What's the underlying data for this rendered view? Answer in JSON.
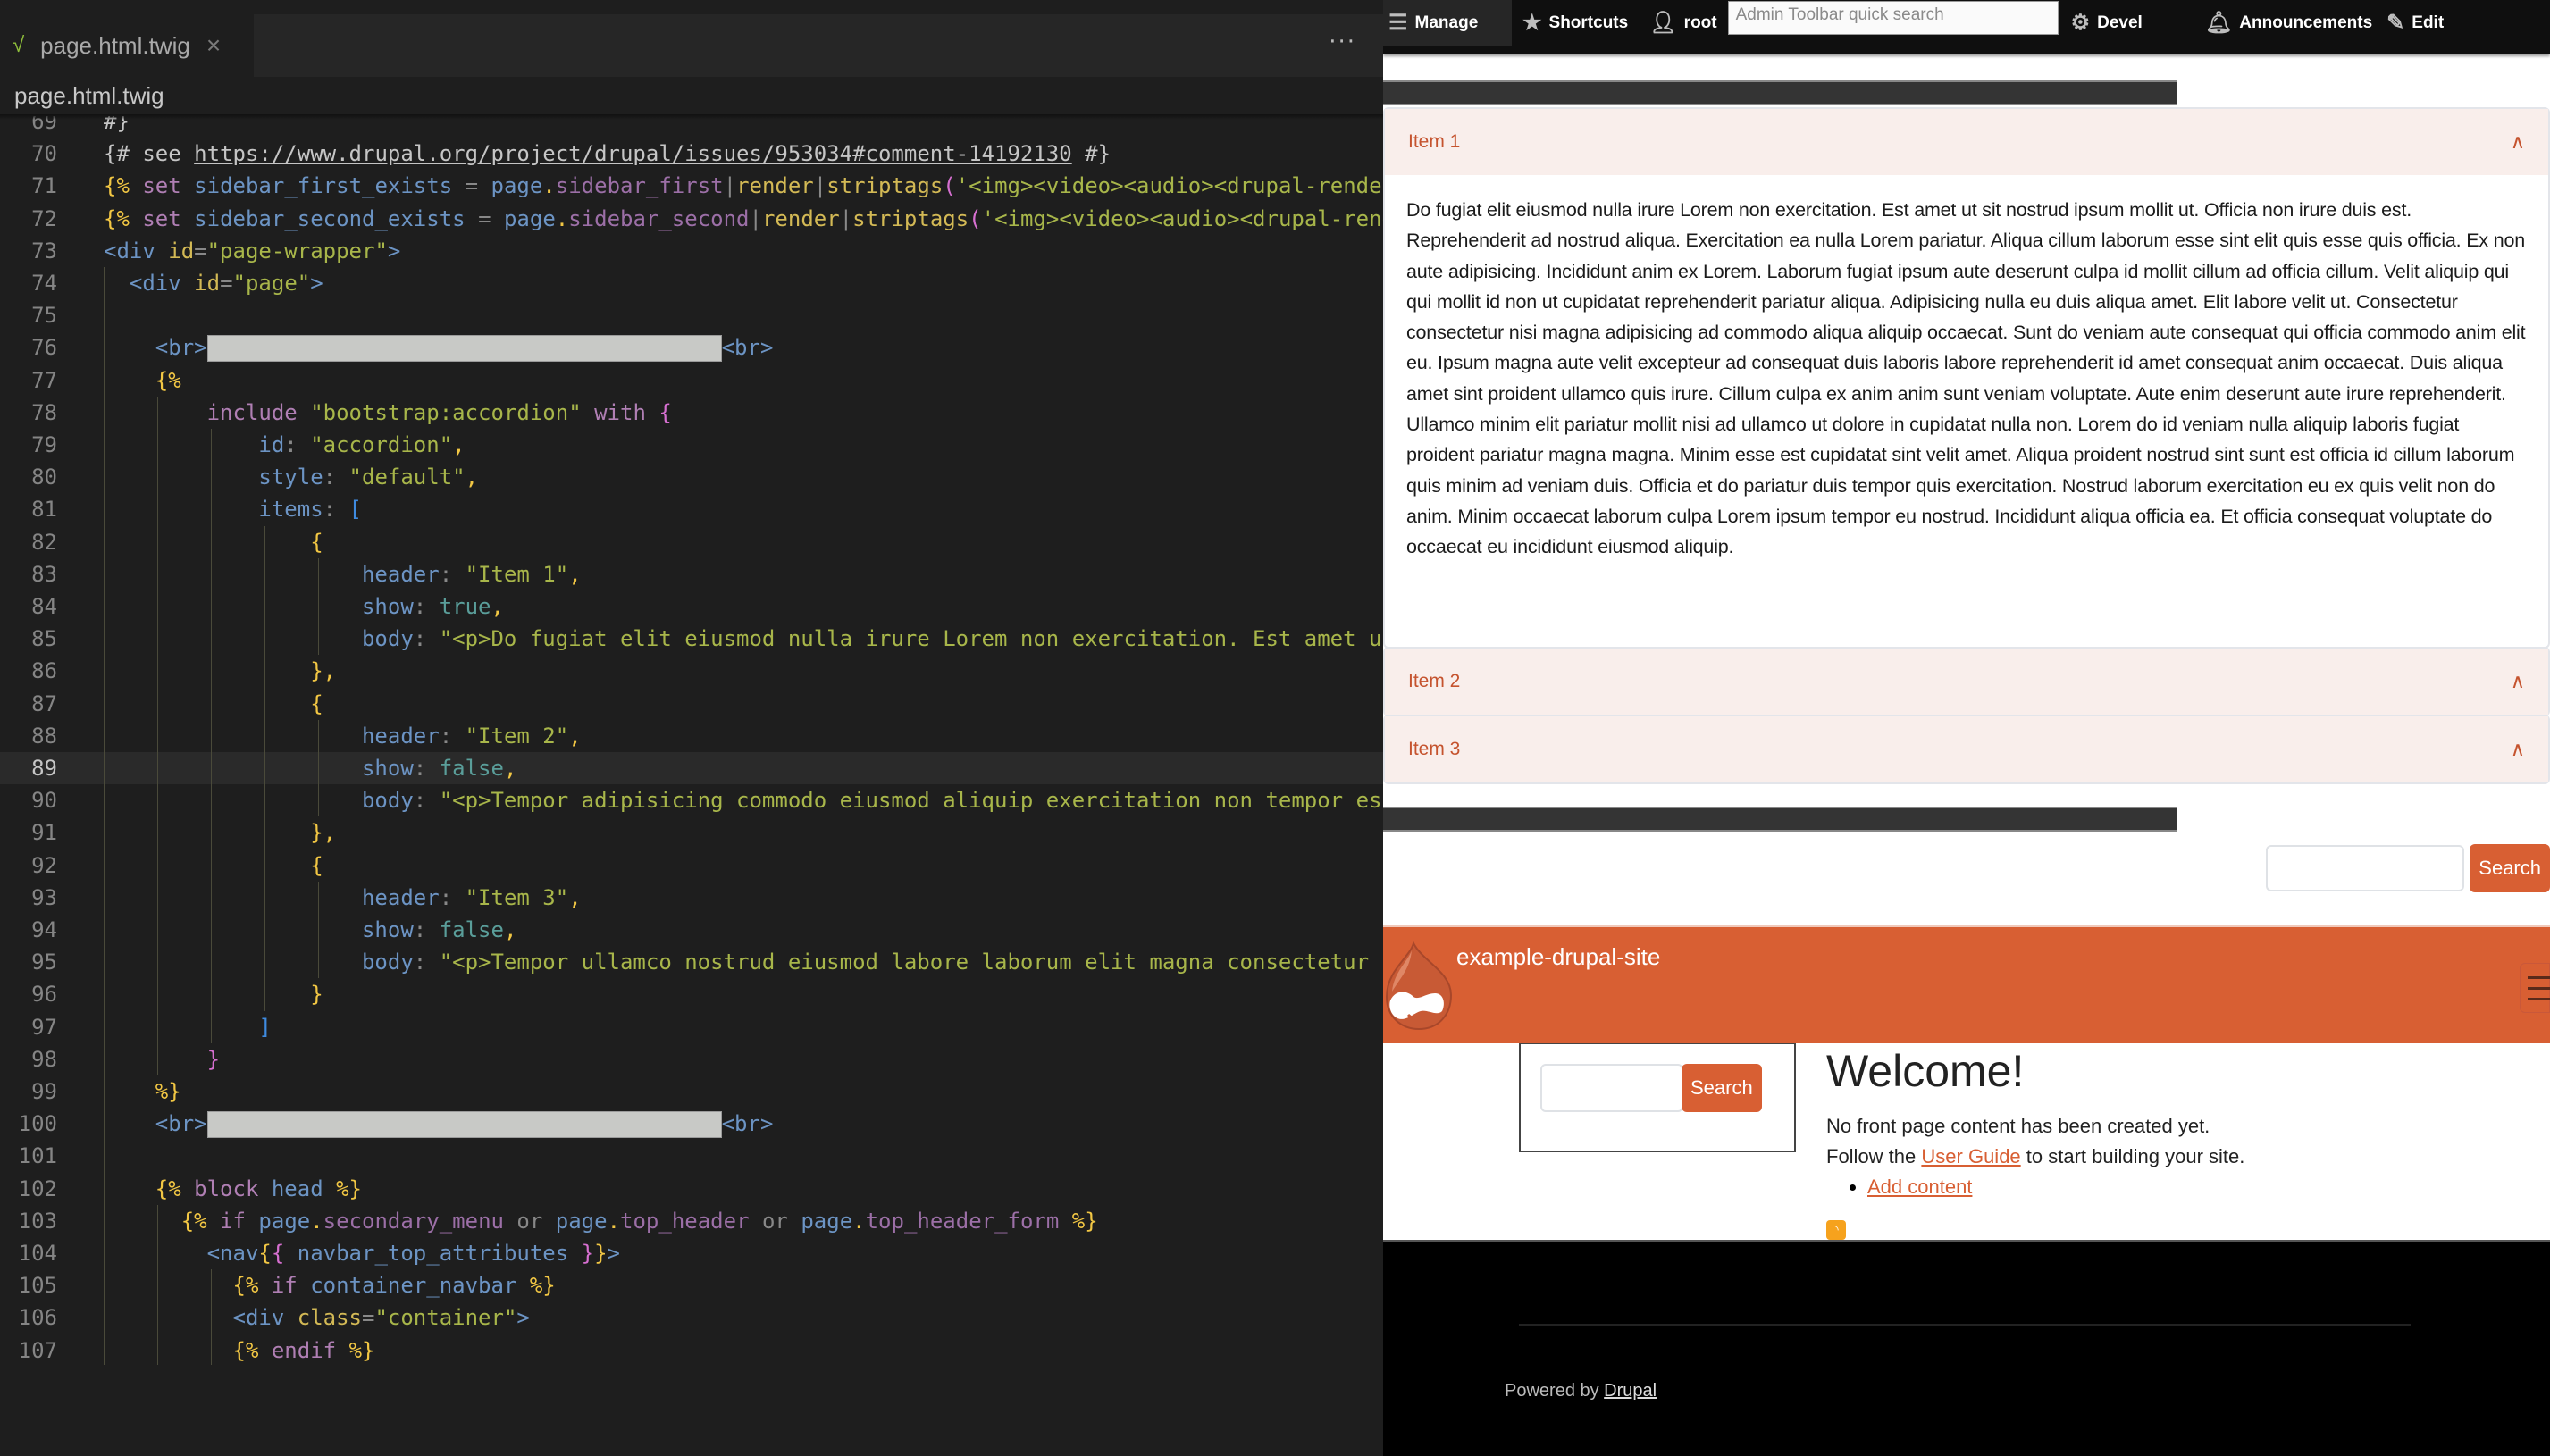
{
  "editor": {
    "tab": {
      "label": "page.html.twig",
      "icon": "twig-file-icon",
      "close": "×"
    },
    "more_actions": "···",
    "breadcrumb": "page.html.twig",
    "active_line": 89,
    "lines": [
      {
        "n": "69",
        "html": "<span class='t-com'>#}</span>",
        "guides": 0
      },
      {
        "n": "70",
        "html": "<span class='t-com'>{# see </span><span class='t-url'>https://www.drupal.org/project/drupal/issues/953034#comment-14192130</span><span class='t-com'> #}</span>",
        "guides": 0
      },
      {
        "n": "71",
        "html": "<span class='t-tw'>{%</span> <span class='t-kw'>set</span> <span class='t-var'>sidebar_first_exists</span> <span class='t-op'>=</span> <span class='t-var'>page</span><span class='t-tw'>.</span><span class='t-prop'>sidebar_first</span><span class='t-op'>|</span><span class='t-flt'>render</span><span class='t-op'>|</span><span class='t-flt'>striptags</span><span class='t-pink'>(</span><span class='t-str'>'&lt;img&gt;&lt;video&gt;&lt;audio&gt;&lt;drupal-render-placeholder&gt;'</span>",
        "guides": 0
      },
      {
        "n": "72",
        "html": "<span class='t-tw'>{%</span> <span class='t-kw'>set</span> <span class='t-var'>sidebar_second_exists</span> <span class='t-op'>=</span> <span class='t-var'>page</span><span class='t-tw'>.</span><span class='t-prop'>sidebar_second</span><span class='t-op'>|</span><span class='t-flt'>render</span><span class='t-op'>|</span><span class='t-flt'>striptags</span><span class='t-pink'>(</span><span class='t-str'>'&lt;img&gt;&lt;video&gt;&lt;audio&gt;&lt;drupal-render-placeholder&gt;'</span>",
        "guides": 0
      },
      {
        "n": "73",
        "html": "<span class='t-br'>&lt;div</span> <span class='t-attr'>id</span><span class='t-op'>=</span><span class='t-str'>\"page-wrapper\"</span><span class='t-br'>&gt;</span>",
        "guides": 0
      },
      {
        "n": "74",
        "html": "  <span class='t-br'>&lt;div</span> <span class='t-attr'>id</span><span class='t-op'>=</span><span class='t-str'>\"page\"</span><span class='t-br'>&gt;</span>",
        "guides": 1
      },
      {
        "n": "75",
        "html": "",
        "guides": 1
      },
      {
        "n": "76",
        "html": "    <span class='t-br'>&lt;br&gt;</span><span class='redact'></span><span class='t-br'>&lt;br&gt;</span>",
        "guides": 1
      },
      {
        "n": "77",
        "html": "    <span class='t-tw'>{%</span>",
        "guides": 1
      },
      {
        "n": "78",
        "html": "        <span class='t-kw'>include</span> <span class='t-str'>\"bootstrap:accordion\"</span> <span class='t-kw'>with</span> <span class='t-pink'>{</span>",
        "guides": 2
      },
      {
        "n": "79",
        "html": "            <span class='t-var'>id</span><span class='t-op'>:</span> <span class='t-str'>\"accordion\"</span><span class='t-tw'>,</span>",
        "guides": 3
      },
      {
        "n": "80",
        "html": "            <span class='t-var'>style</span><span class='t-op'>:</span> <span class='t-str'>\"default\"</span><span class='t-tw'>,</span>",
        "guides": 3
      },
      {
        "n": "81",
        "html": "            <span class='t-var'>items</span><span class='t-op'>:</span> <span class='t-blue'>[</span>",
        "guides": 3
      },
      {
        "n": "82",
        "html": "                <span class='t-tw'>{</span>",
        "guides": 4
      },
      {
        "n": "83",
        "html": "                    <span class='t-var'>header</span><span class='t-op'>:</span> <span class='t-str'>\"Item 1\"</span><span class='t-tw'>,</span>",
        "guides": 5
      },
      {
        "n": "84",
        "html": "                    <span class='t-var'>show</span><span class='t-op'>:</span> <span class='t-bool'>true</span><span class='t-tw'>,</span>",
        "guides": 5
      },
      {
        "n": "85",
        "html": "                    <span class='t-var'>body</span><span class='t-op'>:</span> <span class='t-str'>\"&lt;p&gt;Do fugiat elit eiusmod nulla irure Lorem non exercitation. Est amet ut sit nostrud</span>",
        "guides": 5
      },
      {
        "n": "86",
        "html": "                <span class='t-tw'>}</span><span class='t-tw'>,</span>",
        "guides": 4
      },
      {
        "n": "87",
        "html": "                <span class='t-tw'>{</span>",
        "guides": 4
      },
      {
        "n": "88",
        "html": "                    <span class='t-var'>header</span><span class='t-op'>:</span> <span class='t-str'>\"Item 2\"</span><span class='t-tw'>,</span>",
        "guides": 5
      },
      {
        "n": "89",
        "html": "                    <span class='t-var'>show</span><span class='t-op'>:</span> <span class='t-bool'>false</span><span class='t-tw'>,</span>",
        "guides": 5
      },
      {
        "n": "90",
        "html": "                    <span class='t-var'>body</span><span class='t-op'>:</span> <span class='t-str'>\"&lt;p&gt;Tempor adipisicing commodo eiusmod aliquip exercitation non tempor est</span>",
        "guides": 5
      },
      {
        "n": "91",
        "html": "                <span class='t-tw'>}</span><span class='t-tw'>,</span>",
        "guides": 4
      },
      {
        "n": "92",
        "html": "                <span class='t-tw'>{</span>",
        "guides": 4
      },
      {
        "n": "93",
        "html": "                    <span class='t-var'>header</span><span class='t-op'>:</span> <span class='t-str'>\"Item 3\"</span><span class='t-tw'>,</span>",
        "guides": 5
      },
      {
        "n": "94",
        "html": "                    <span class='t-var'>show</span><span class='t-op'>:</span> <span class='t-bool'>false</span><span class='t-tw'>,</span>",
        "guides": 5
      },
      {
        "n": "95",
        "html": "                    <span class='t-var'>body</span><span class='t-op'>:</span> <span class='t-str'>\"&lt;p&gt;Tempor ullamco nostrud eiusmod labore laborum elit magna consectetur</span>",
        "guides": 5
      },
      {
        "n": "96",
        "html": "                <span class='t-tw'>}</span>",
        "guides": 4
      },
      {
        "n": "97",
        "html": "            <span class='t-blue'>]</span>",
        "guides": 3
      },
      {
        "n": "98",
        "html": "        <span class='t-pink'>}</span>",
        "guides": 2
      },
      {
        "n": "99",
        "html": "    <span class='t-tw'>%}</span>",
        "guides": 1
      },
      {
        "n": "100",
        "html": "    <span class='t-br'>&lt;br&gt;</span><span class='redact'></span><span class='t-br'>&lt;br&gt;</span>",
        "guides": 1
      },
      {
        "n": "101",
        "html": "",
        "guides": 1
      },
      {
        "n": "102",
        "html": "    <span class='t-tw'>{%</span> <span class='t-kw'>block</span> <span class='t-var'>head</span> <span class='t-tw'>%}</span>",
        "guides": 1
      },
      {
        "n": "103",
        "html": "      <span class='t-tw'>{%</span> <span class='t-kw'>if</span> <span class='t-var'>page</span><span class='t-tw'>.</span><span class='t-prop'>secondary_menu</span> <span class='t-op'>or</span> <span class='t-var'>page</span><span class='t-tw'>.</span><span class='t-prop'>top_header</span> <span class='t-op'>or</span> <span class='t-var'>page</span><span class='t-tw'>.</span><span class='t-prop'>top_header_form</span> <span class='t-tw'>%}</span>",
        "guides": 2
      },
      {
        "n": "104",
        "html": "        <span class='t-br'>&lt;nav</span><span class='t-tw'>{</span><span class='t-pink'>{</span> <span class='t-var'>navbar_top_attributes</span> <span class='t-pink'>}</span><span class='t-tw'>}</span><span class='t-br'>&gt;</span>",
        "guides": 2
      },
      {
        "n": "105",
        "html": "          <span class='t-tw'>{%</span> <span class='t-kw'>if</span> <span class='t-var'>container_navbar</span> <span class='t-tw'>%}</span>",
        "guides": 3
      },
      {
        "n": "106",
        "html": "          <span class='t-br'>&lt;div</span> <span class='t-attr'>class</span><span class='t-op'>=</span><span class='t-str'>\"container\"</span><span class='t-br'>&gt;</span>",
        "guides": 3
      },
      {
        "n": "107",
        "html": "          <span class='t-tw'>{%</span> <span class='t-kw'>endif</span> <span class='t-tw'>%}</span>",
        "guides": 3
      }
    ]
  },
  "browser": {
    "toolbar": {
      "manage": "Manage",
      "shortcuts": "Shortcuts",
      "user": "root",
      "search_placeholder": "Admin Toolbar quick search",
      "devel": "Devel",
      "announcements": "Announcements",
      "edit": "Edit"
    },
    "accordion": {
      "items": [
        {
          "header": "Item 1",
          "expanded": true,
          "body": "Do fugiat elit eiusmod nulla irure Lorem non exercitation. Est amet ut sit nostrud ipsum mollit ut. Officia non irure duis est. Reprehenderit ad nostrud aliqua. Exercitation ea nulla Lorem pariatur. Aliqua cillum laborum esse sint elit quis esse quis officia. Ex non aute adipisicing. Incididunt anim ex Lorem. Laborum fugiat ipsum aute deserunt culpa id mollit cillum ad officia cillum. Velit aliquip qui qui mollit id non ut cupidatat reprehenderit pariatur aliqua. Adipisicing nulla eu duis aliqua amet. Elit labore velit ut. Consectetur consectetur nisi magna adipisicing ad commodo aliqua aliquip occaecat. Sunt do veniam aute consequat qui officia commodo anim elit eu. Ipsum magna aute velit excepteur ad consequat duis laboris labore reprehenderit id amet consequat anim occaecat. Duis aliqua amet sint proident ullamco quis irure. Cillum culpa ex anim anim sunt veniam voluptate. Aute enim deserunt aute irure reprehenderit. Ullamco minim elit pariatur mollit nisi ad ullamco ut dolore in cupidatat nulla non. Lorem do id veniam nulla aliquip laboris fugiat proident pariatur magna magna. Minim esse est cupidatat sint velit amet. Aliqua proident nostrud sint sunt est officia id cillum laborum quis minim ad veniam duis. Officia et do pariatur duis tempor quis exercitation. Nostrud laborum exercitation eu ex quis velit non do anim. Minim occaecat laborum culpa Lorem ipsum tempor eu nostrud. Incididunt aliqua officia ea. Et officia consequat voluptate do occaecat eu incididunt eiusmod aliquip."
        },
        {
          "header": "Item 2",
          "expanded": false
        },
        {
          "header": "Item 3",
          "expanded": false
        }
      ]
    },
    "top_search": {
      "value": "",
      "button": "Search"
    },
    "site": {
      "name": "example-drupal-site",
      "accent": "#d85f33"
    },
    "sidebar_search": {
      "value": "",
      "button": "Search"
    },
    "welcome": {
      "title": "Welcome!",
      "line1": "No front page content has been created yet.",
      "line2_before": "Follow the ",
      "line2_link": "User Guide",
      "line2_after": " to start building your site.",
      "add_content": "Add content"
    },
    "footer": {
      "powered_by": "Powered by ",
      "drupal_link": "Drupal"
    }
  }
}
